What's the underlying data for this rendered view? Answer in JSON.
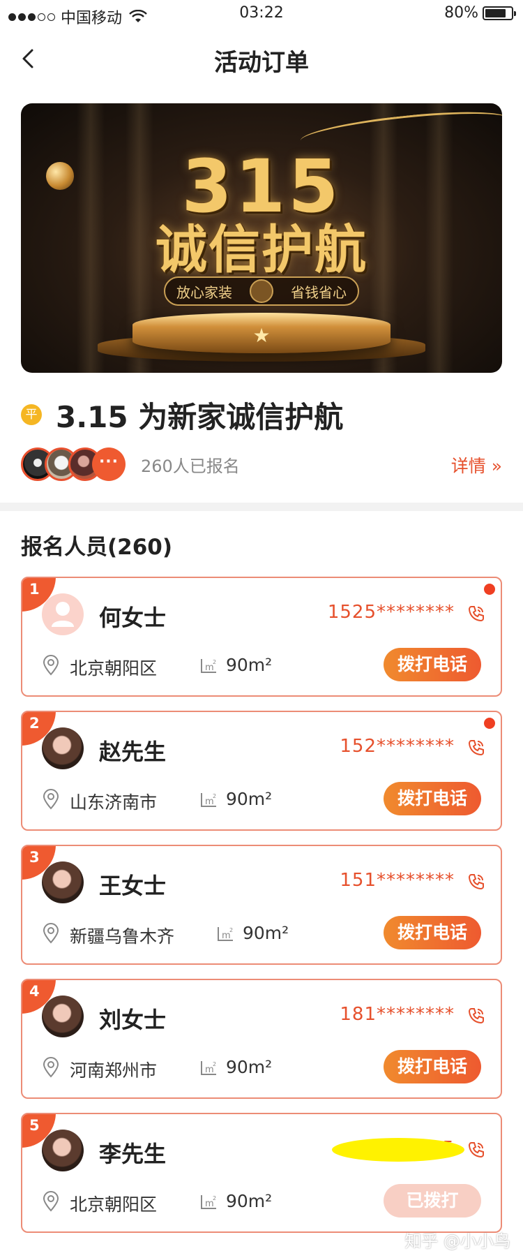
{
  "status_bar": {
    "carrier": "中国移动",
    "time": "03:22",
    "battery_percent": "80%",
    "battery_level": 0.8
  },
  "nav": {
    "title": "活动订单"
  },
  "activity": {
    "tag": "平",
    "title": "3.15 为新家诚信护航",
    "signup_count": "260人已报名",
    "details_link": "详情 »",
    "more_label": "···"
  },
  "banner": {
    "big_number": "315",
    "headline": "诚信护航",
    "pill_left": "放心家装",
    "pill_right": "省钱省心"
  },
  "section": {
    "title": "报名人员(260)"
  },
  "registrants": [
    {
      "rank": "1",
      "name": "何女士",
      "phone": "1525********",
      "location": "北京朝阳区",
      "area": "90m²",
      "button": "拨打电话",
      "unread": true,
      "called": false
    },
    {
      "rank": "2",
      "name": "赵先生",
      "phone": "152********",
      "location": "山东济南市",
      "area": "90m²",
      "button": "拨打电话",
      "unread": true,
      "called": false
    },
    {
      "rank": "3",
      "name": "王女士",
      "phone": "151********",
      "location": "新疆乌鲁木齐",
      "area": "90m²",
      "button": "拨打电话",
      "unread": false,
      "called": false
    },
    {
      "rank": "4",
      "name": "刘女士",
      "phone": "181********",
      "location": "河南郑州市",
      "area": "90m²",
      "button": "拨打电话",
      "unread": false,
      "called": false
    },
    {
      "rank": "5",
      "name": "李先生",
      "phone": "15",
      "location": "北京朝阳区",
      "area": "90m²",
      "button": "已拨打",
      "unread": false,
      "called": true
    }
  ],
  "watermark": "知乎 @小小鸟",
  "colors": {
    "accent": "#ef5a30",
    "card_border": "#ec8c76",
    "badge_yellow": "#f5b623"
  },
  "icons": {
    "back": "chevron-left-icon",
    "wifi": "wifi-icon",
    "phone": "phone-icon",
    "location": "location-pin-icon",
    "area": "area-m2-icon",
    "person": "person-icon"
  }
}
